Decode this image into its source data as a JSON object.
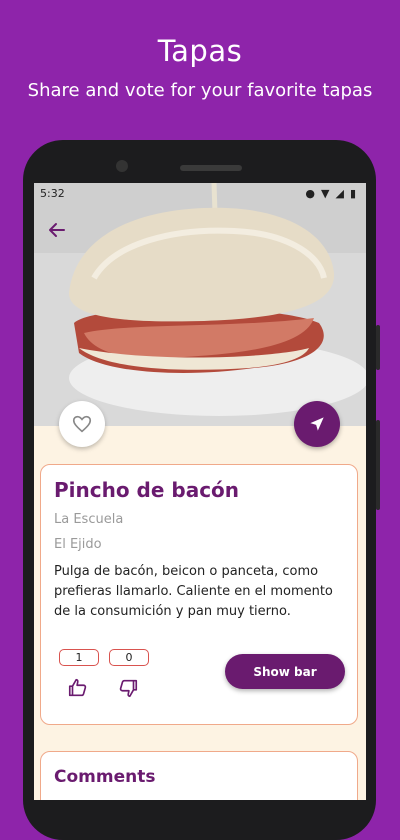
{
  "promo": {
    "title": "Tapas",
    "subtitle": "Share and vote for your favorite tapas"
  },
  "statusbar": {
    "time": "5:32"
  },
  "detail": {
    "tapa_name": "Pincho de bacón",
    "bar_name": "La Escuela",
    "town": "El Ejido",
    "description": "Pulga de bacón, beicon o panceta, como prefieras llamarlo. Caliente en el momento de la consumición y pan muy tierno.",
    "likes": "1",
    "dislikes": "0",
    "show_bar_label": "Show bar"
  },
  "comments": {
    "title": "Comments"
  },
  "colors": {
    "background": "#8e24aa",
    "accent": "#6a1b6f",
    "screen_background": "#fdf3e3",
    "card_border": "#f0a98a"
  }
}
